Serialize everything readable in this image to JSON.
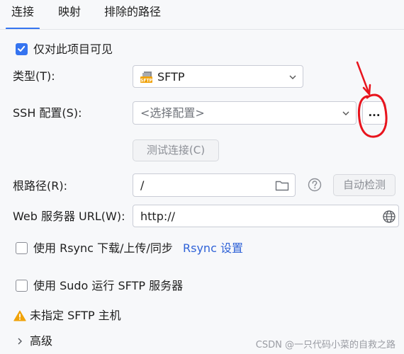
{
  "tabs": [
    {
      "label": "连接",
      "active": true
    },
    {
      "label": "映射",
      "active": false
    },
    {
      "label": "排除的路径",
      "active": false
    }
  ],
  "visible_only": {
    "label": "仅对此项目可见",
    "checked": true
  },
  "type_row": {
    "label": "类型(T):",
    "selected": "SFTP",
    "icon": "sftp-icon"
  },
  "ssh_row": {
    "label": "SSH 配置(S):",
    "placeholder": "<选择配置>",
    "more_label": "..."
  },
  "test_button": {
    "label": "测试连接(C)"
  },
  "root_row": {
    "label": "根路径(R):",
    "value": "/",
    "auto_detect_label": "自动检测"
  },
  "web_row": {
    "label": "Web 服务器 URL(W):",
    "value": "http://"
  },
  "rsync": {
    "label": "使用 Rsync 下载/上传/同步",
    "link": "Rsync 设置",
    "checked": false
  },
  "sudo": {
    "label": "使用 Sudo 运行 SFTP 服务器",
    "checked": false
  },
  "warning": {
    "text": "未指定 SFTP 主机"
  },
  "advanced": {
    "label": "高级"
  },
  "watermark": "CSDN @一只代码小菜的自救之路",
  "colors": {
    "accent": "#3574f0",
    "annotation": "#e8141d",
    "warning": "#f0a30a"
  }
}
